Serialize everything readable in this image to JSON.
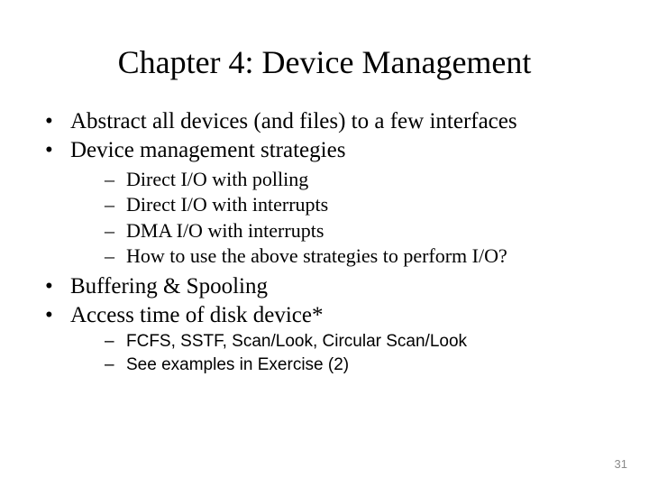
{
  "title": "Chapter 4: Device Management",
  "bullets": {
    "b0": "Abstract all devices (and files) to a few interfaces",
    "b1": "Device management strategies",
    "b1_sub": {
      "s0": "Direct I/O with polling",
      "s1": "Direct I/O with interrupts",
      "s2": "DMA I/O with interrupts",
      "s3": "How to use the above strategies to perform I/O?"
    },
    "b2": "Buffering & Spooling",
    "b3": "Access time of disk device*",
    "b3_sub": {
      "s0": "FCFS, SSTF, Scan/Look, Circular Scan/Look",
      "s1": "See examples in Exercise (2)"
    }
  },
  "page_number": "31"
}
